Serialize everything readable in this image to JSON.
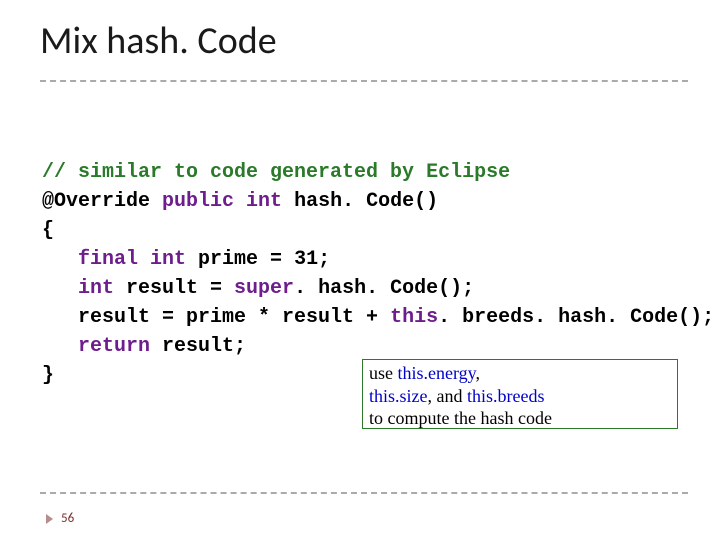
{
  "title": "Mix hash. Code",
  "code": {
    "comment": "// similar to code generated by Eclipse",
    "l2a": "@Override ",
    "l2b": "public ",
    "l2c": "int",
    "l2d": " hash. Code()",
    "l3": "{",
    "l4a": "   final ",
    "l4b": "int",
    "l4c": " prime = 31;",
    "l5a": "   int",
    "l5b": " result = ",
    "l5c": "super",
    "l5d": ". hash. Code();",
    "l6a": "   result = prime * result + ",
    "l6b": "this",
    "l6c": ". breeds. hash. Code();",
    "l7a": "   return",
    "l7b": " result;",
    "l8": "}"
  },
  "note": {
    "l1a": "use ",
    "l1b": "this.",
    "l1c": "energy",
    "l1d": ", ",
    "l2a": "this.",
    "l2b": "size",
    "l2c": ", and ",
    "l2d": "this.",
    "l2e": "breeds",
    "l3": " to compute the hash code"
  },
  "page_number": "56"
}
